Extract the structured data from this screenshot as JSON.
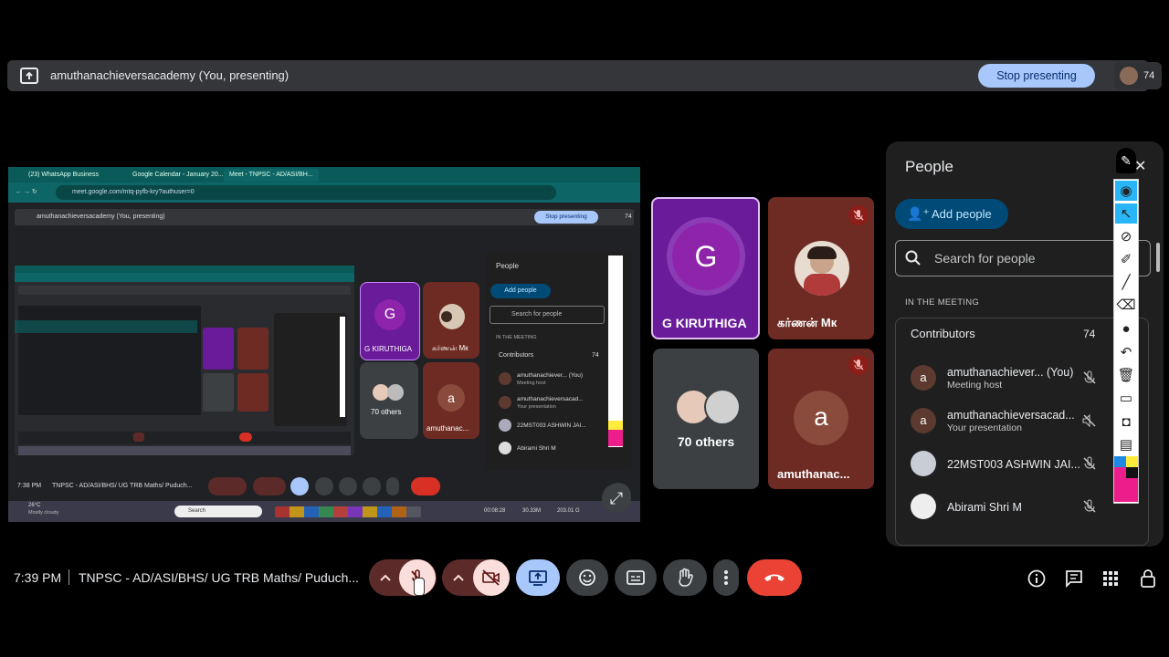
{
  "presenting_bar": {
    "title": "amuthanachieversacademy (You, presenting)",
    "stop_label": "Stop presenting",
    "participant_count": "74"
  },
  "shared_screen": {
    "tabs": [
      "(23) WhatsApp Business",
      "Google Calendar - January 20...",
      "Meet - TNPSC - AD/ASI/BH..."
    ],
    "url": "meet.google.com/mtq-pyfb-kry?authuser=0",
    "inner_presenting": "amuthanachieversacademy (You, presenting)",
    "inner_stop": "Stop presenting",
    "inner_count": "74",
    "inner_people_title": "People",
    "inner_add_people": "Add people",
    "inner_search": "Search for people",
    "inner_in_meeting": "IN THE MEETING",
    "inner_contributors": "Contributors",
    "inner_contrib_count": "74",
    "inner_rows": [
      {
        "name": "amuthanachiever... (You)",
        "sub": "Meeting host"
      },
      {
        "name": "amuthanachieversacad...",
        "sub": "Your presentation"
      },
      {
        "name": "22MST003 ASHWIN JAI...",
        "sub": ""
      },
      {
        "name": "Abirami Shri M",
        "sub": ""
      }
    ],
    "inner_tiles": [
      "G KIRUTHIGA",
      "கர்ணன் Mк",
      "70 others",
      "amuthanac..."
    ],
    "inner_time": "7:38 PM",
    "inner_meeting": "TNPSC - AD/ASI/BHS/ UG TRB Maths/ Puduch...",
    "taskbar": {
      "weather": "26°C",
      "weather_sub": "Mostly cloudy",
      "search": "Search",
      "rec_time": "00:08:28",
      "rec_size1": "30.33M",
      "rec_size2": "203.01 G"
    }
  },
  "tiles": [
    {
      "name": "G KIRUTHIGA",
      "initial": "G"
    },
    {
      "name": "கர்ணன் Mк"
    },
    {
      "name": "70 others"
    },
    {
      "name": "amuthanac...",
      "initial": "a"
    }
  ],
  "people_panel": {
    "title": "People",
    "add_people": "Add people",
    "search_placeholder": "Search for people",
    "in_meeting": "IN THE MEETING",
    "contributors_label": "Contributors",
    "contributors_count": "74",
    "rows": [
      {
        "name": "amuthanachiever...",
        "tag": "(You)",
        "sub": "Meeting host",
        "initial": "a"
      },
      {
        "name": "amuthanachieversacad...",
        "tag": "",
        "sub": "Your presentation",
        "initial": "a"
      },
      {
        "name": "22MST003 ASHWIN JAI...",
        "tag": "",
        "sub": ""
      },
      {
        "name": "Abirami Shri M",
        "tag": "",
        "sub": ""
      }
    ]
  },
  "bottom_bar": {
    "time": "7:39 PM",
    "meeting_title": "TNPSC - AD/ASI/BHS/ UG TRB Maths/ Puduch..."
  },
  "colors": {
    "accent": "#a8c7fa",
    "end_call": "#ea4335",
    "mic_off_bg": "#f9dedc",
    "tile_purple": "#6a1b9a"
  }
}
